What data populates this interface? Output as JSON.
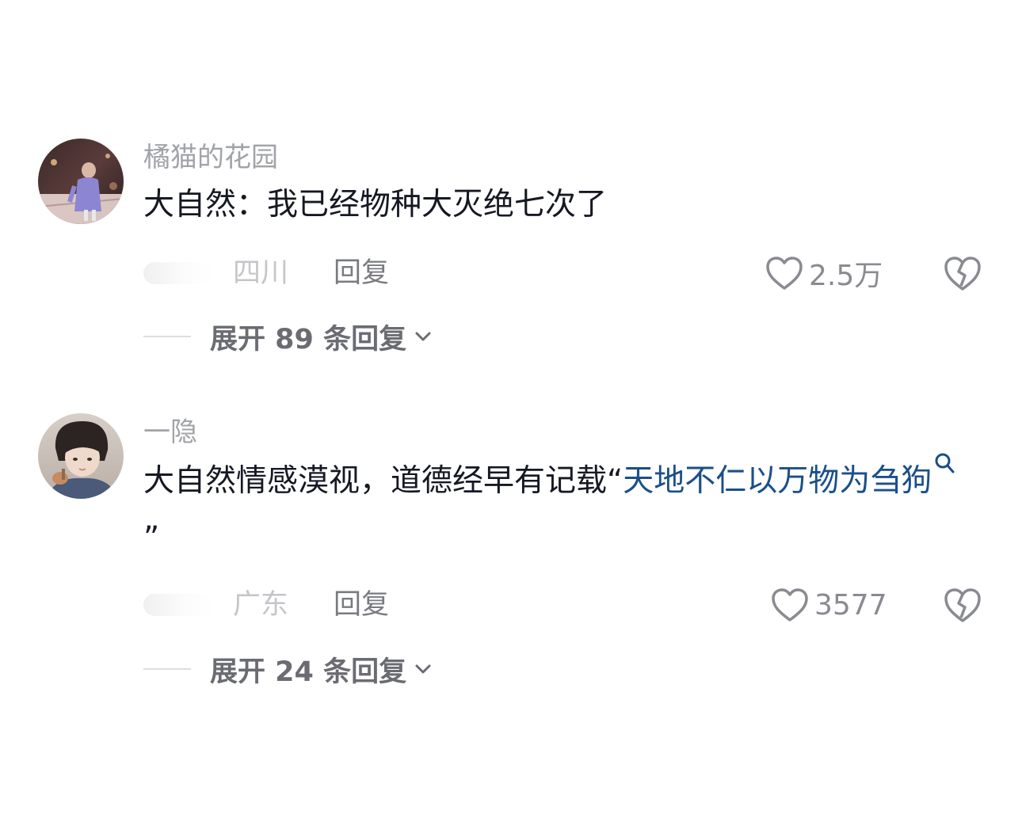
{
  "comments": [
    {
      "username": "橘猫的花园",
      "text_plain": "大自然：我已经物种大灭绝七次了",
      "location": "四川",
      "reply_label": "回复",
      "likes": "2.5万",
      "expand_label": "展开 89 条回复",
      "icons": [
        "heart-outline-icon",
        "broken-heart-icon",
        "chevron-down-icon"
      ]
    },
    {
      "username": "一隐",
      "text_plain": "大自然情感漠视，道德经早有记载“",
      "text_link": "天地不仁以万物为刍狗",
      "text_tail": "”",
      "location": "广东",
      "reply_label": "回复",
      "likes": "3577",
      "expand_label": "展开 24 条回复",
      "icons": [
        "heart-outline-icon",
        "broken-heart-icon",
        "search-icon",
        "chevron-down-icon"
      ]
    }
  ],
  "colors": {
    "username": "#a2a3a8",
    "text": "#161823",
    "link": "#1a4f8a",
    "meta": "#c5c6c9",
    "reply": "#7a7b80"
  }
}
